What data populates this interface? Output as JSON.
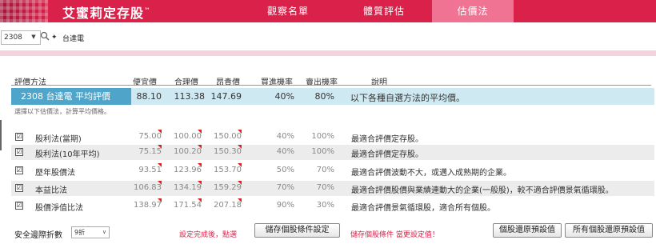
{
  "header": {
    "brand": "艾蜜莉定存股",
    "brand_mark": "™",
    "tabs": [
      "觀察名單",
      "體質評估",
      "估價法"
    ],
    "active_tab": "估價法",
    "colors": {
      "bar": "#d9214a",
      "active": "#f07393"
    }
  },
  "selector": {
    "stock_code": "2308",
    "stock_name": "台達電",
    "icons": [
      "chevron-down-icon",
      "search-icon",
      "plus-icon"
    ]
  },
  "table": {
    "headers": [
      "評價方法",
      "便宜價",
      "合理價",
      "昂貴價",
      "買進機率",
      "賣出機率",
      "說明"
    ],
    "average": {
      "label": "2308 台達電  平均評價",
      "cheap": "88.10",
      "fair": "113.38",
      "expensive": "147.69",
      "buy": "40%",
      "sell": "80%",
      "desc": "以下各種自選方法的平均價。"
    },
    "hint": "選擇以下估價法，計算平均價格。",
    "rows": [
      {
        "name": "股利法(當期)",
        "cheap": "75.00",
        "fair": "100.00",
        "expensive": "150.00",
        "buy": "40%",
        "sell": "100%",
        "desc": "最適合評價定存股。",
        "checked": "☑"
      },
      {
        "name": "股利法(10年平均)",
        "cheap": "75.15",
        "fair": "100.20",
        "expensive": "150.30",
        "buy": "40%",
        "sell": "100%",
        "desc": "最適合評價定存股。",
        "checked": "☑"
      },
      {
        "name": "歷年股價法",
        "cheap": "93.51",
        "fair": "123.96",
        "expensive": "153.70",
        "buy": "50%",
        "sell": "70%",
        "desc": "最適合評價波動不大，或邁入成熟期的企業。",
        "checked": "☑"
      },
      {
        "name": "本益比法",
        "cheap": "106.83",
        "fair": "134.19",
        "expensive": "159.29",
        "buy": "70%",
        "sell": "70%",
        "desc": "最適合評價股價與業績連動大的企業(一般股)，較不適合評價景氣循環股。",
        "checked": "☑"
      },
      {
        "name": "股價淨值比法",
        "cheap": "138.97",
        "fair": "171.54",
        "expensive": "207.18",
        "buy": "90%",
        "sell": "30%",
        "desc": "最適合評價景氣循環股，適合所有個股。",
        "checked": "☑"
      }
    ]
  },
  "footer": {
    "discount_label": "安全邊際折數",
    "discount_value": "9折",
    "note1": "設定完成後，點選",
    "save_button": "儲存個股條件設定",
    "note2": "儲存個股條件 當更設定值！",
    "reset_button": "個股還原預設值",
    "reset_all_button": "所有個股還原預設值"
  }
}
